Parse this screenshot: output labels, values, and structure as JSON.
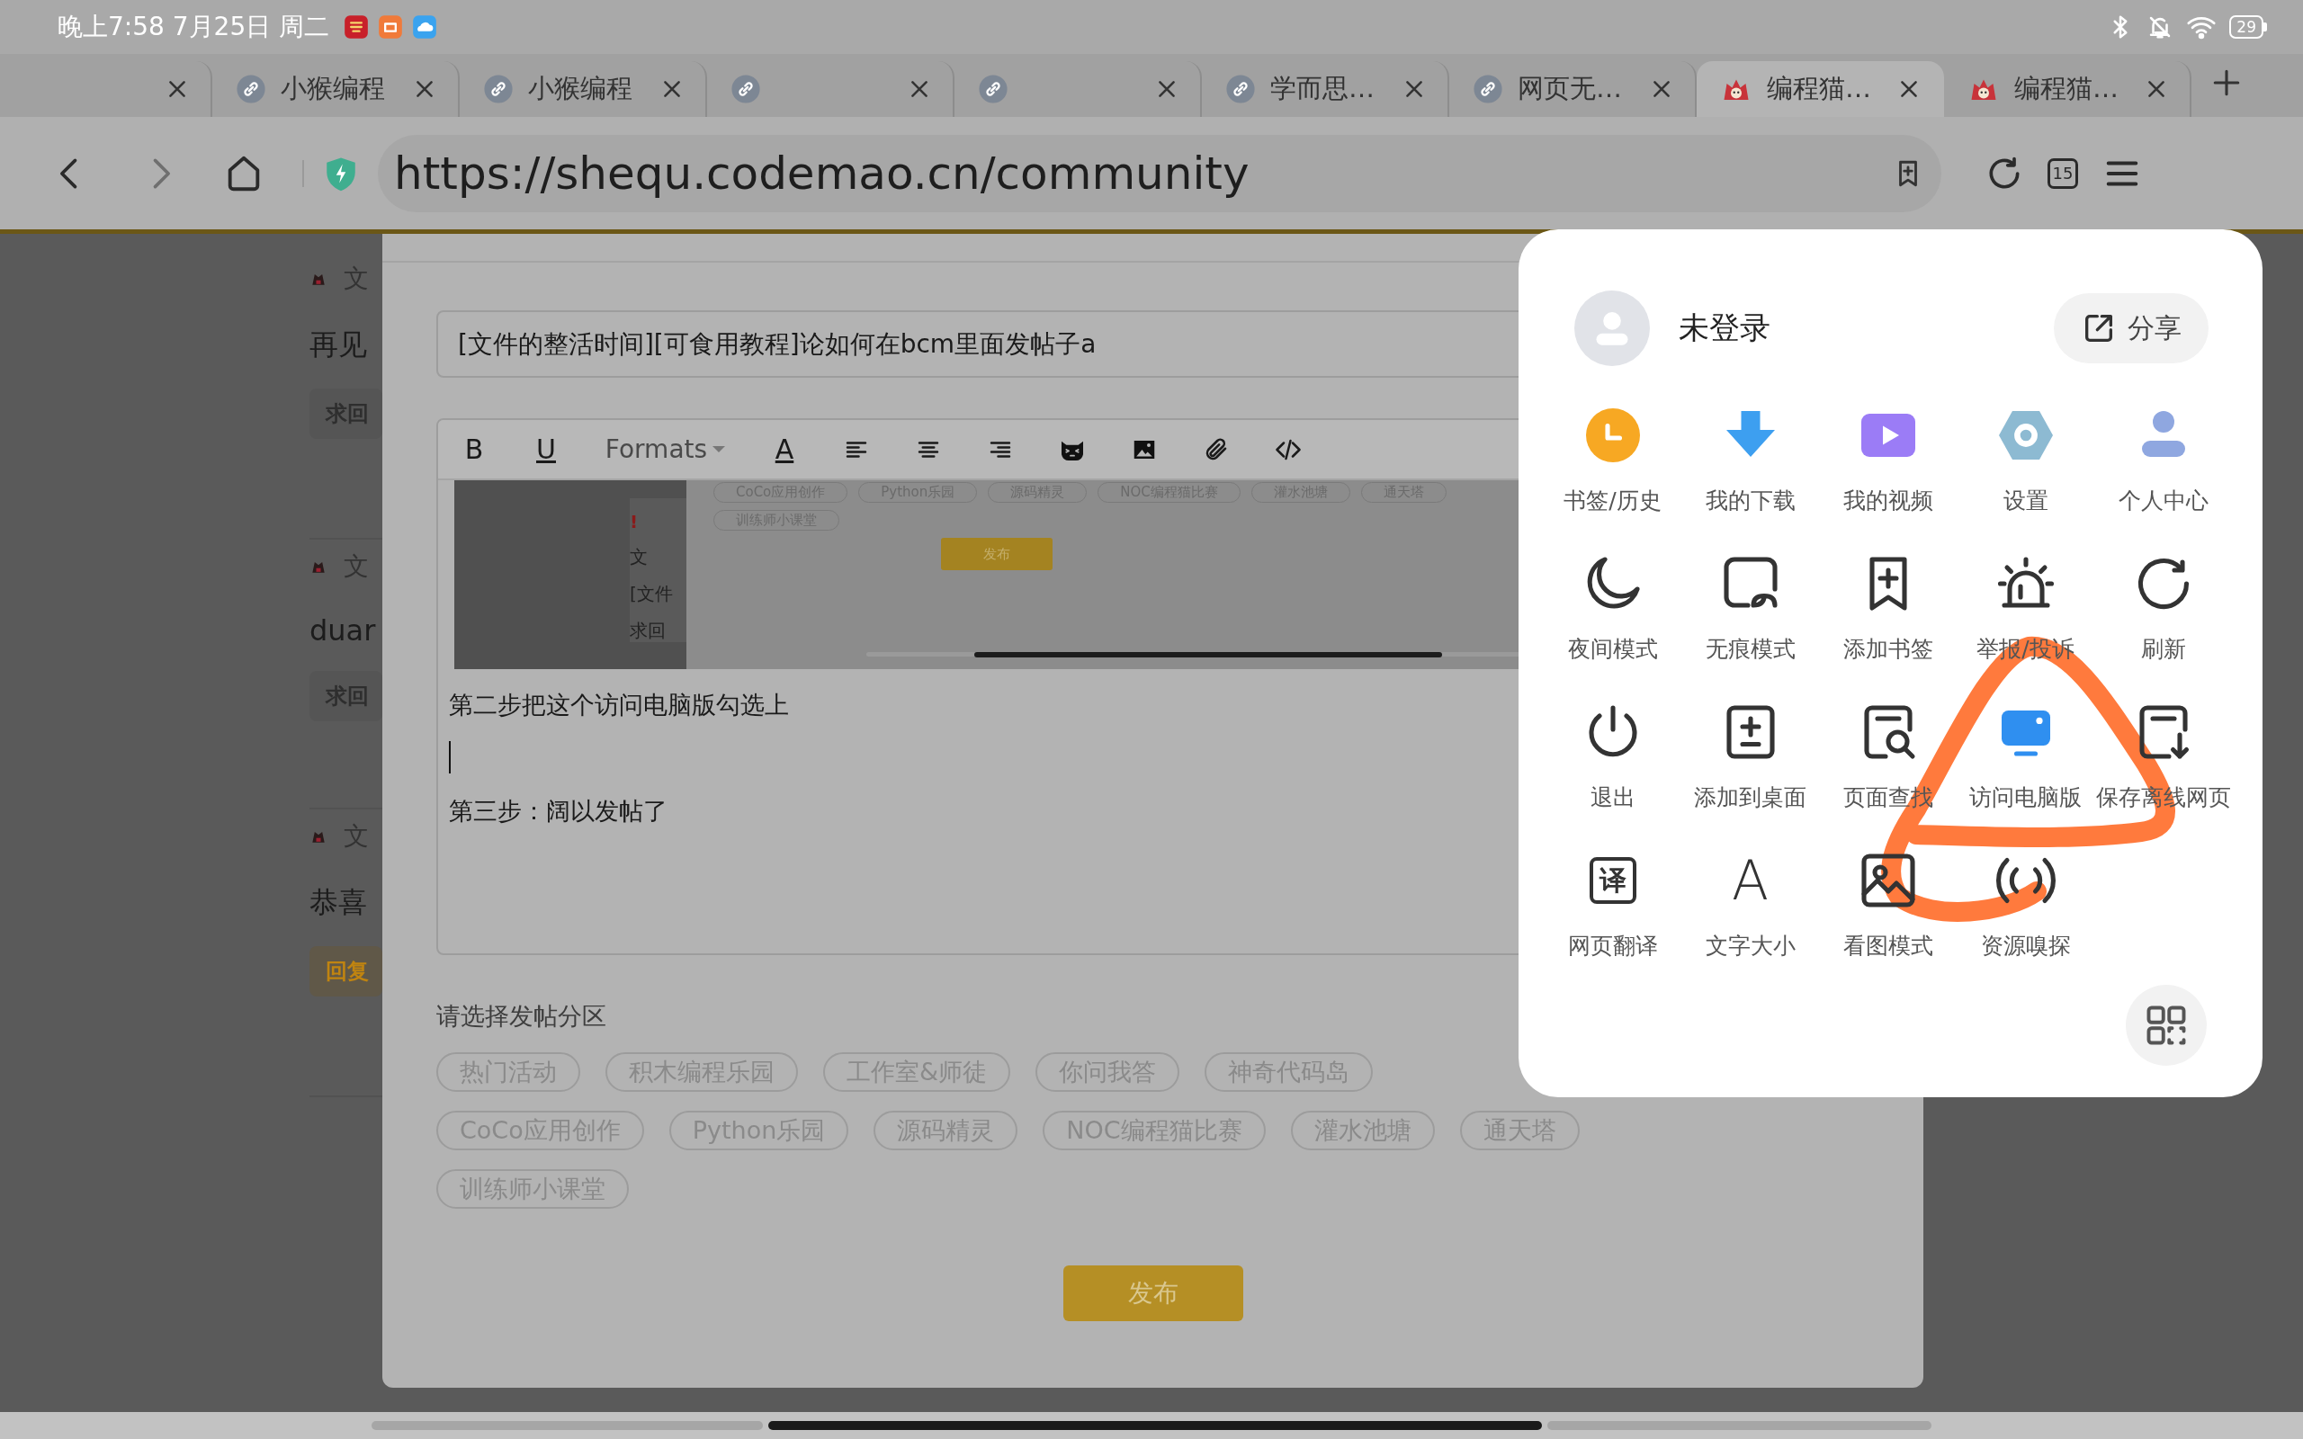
{
  "status_bar": {
    "time": "晚上7:58 7月25日 周二",
    "battery": "29"
  },
  "tabs": [
    {
      "kind": "blank",
      "selected": false
    },
    {
      "kind": "link",
      "label": "小猴编程",
      "selected": false
    },
    {
      "kind": "link",
      "label": "小猴编程",
      "selected": false
    },
    {
      "kind": "link",
      "selected": false
    },
    {
      "kind": "link",
      "selected": false
    },
    {
      "kind": "link",
      "label": "学而思…",
      "selected": false
    },
    {
      "kind": "link",
      "label": "网页无…",
      "selected": false
    },
    {
      "kind": "mascot",
      "label": "编程猫…",
      "selected": true
    },
    {
      "kind": "mascot",
      "label": "编程猫…",
      "selected": false
    }
  ],
  "address_bar": {
    "url": "https://shequ.codemao.cn/community",
    "tab_count": "15"
  },
  "sidebar_posts": [
    {
      "head": "文",
      "title": "再见",
      "tag": "求回",
      "highlighted": false
    },
    {
      "head": "文",
      "title": "duar",
      "tag": "求回",
      "highlighted": false
    },
    {
      "head": "文",
      "title": "恭喜",
      "tag": "回复",
      "highlighted": true
    }
  ],
  "editor": {
    "title": "[文件的整活时间][可食用教程]论如何在bcm里面发帖子a",
    "toolbar": {
      "bold": "B",
      "underline": "U",
      "formats": "Formats",
      "font_color": "A"
    },
    "screenshot": {
      "mark": "!",
      "head": "文",
      "title": "[文件",
      "tag": "求回",
      "tag_rows": [
        [
          "CoCo应用创作",
          "Python乐园",
          "源码精灵",
          "NOC编程猫比赛",
          "灌水池塘",
          "通天塔"
        ],
        [
          "训练师小课堂"
        ]
      ],
      "button": "发布"
    },
    "paragraphs": [
      "第二步把这个访问电脑版勾选上",
      "第三步：阔以发帖了"
    ],
    "section_label": "请选择发帖分区",
    "section_rows": [
      [
        {
          "label": "热门活动",
          "selected": false
        },
        {
          "label": "积木编程乐园",
          "selected": false
        },
        {
          "label": "工作室&师徒",
          "selected": false
        },
        {
          "label": "你问我答",
          "selected": false
        },
        {
          "label": "神奇代码岛",
          "selected": false
        }
      ],
      [
        {
          "label": "CoCo应用创作",
          "selected": false
        },
        {
          "label": "Python乐园",
          "selected": false
        },
        {
          "label": "源码精灵",
          "selected": false
        },
        {
          "label": "NOC编程猫比赛",
          "selected": false
        },
        {
          "label": "灌水池塘",
          "selected": false
        },
        {
          "label": "通天塔",
          "selected": false
        }
      ],
      [
        {
          "label": "训练师小课堂",
          "selected": false
        }
      ]
    ],
    "publish": "发布"
  },
  "menu": {
    "user": "未登录",
    "share": "分享",
    "items": [
      {
        "kind": "icon",
        "label": "书签/历史",
        "on": false
      },
      {
        "kind": "icon",
        "label": "我的下载",
        "on": false
      },
      {
        "kind": "icon",
        "label": "我的视频",
        "on": false
      },
      {
        "kind": "icon",
        "label": "设置",
        "on": false
      },
      {
        "kind": "icon",
        "label": "个人中心",
        "on": false
      },
      {
        "kind": "icon",
        "label": "夜间模式",
        "on": false
      },
      {
        "kind": "icon",
        "label": "无痕模式",
        "on": false
      },
      {
        "kind": "icon",
        "label": "添加书签",
        "on": false
      },
      {
        "kind": "icon",
        "label": "举报/投诉",
        "on": false
      },
      {
        "kind": "icon",
        "label": "刷新",
        "on": false
      },
      {
        "kind": "icon",
        "label": "退出",
        "on": false
      },
      {
        "kind": "icon",
        "label": "添加到桌面",
        "on": false
      },
      {
        "kind": "icon",
        "label": "页面查找",
        "on": false
      },
      {
        "kind": "icon",
        "label": "访问电脑版",
        "on": true
      },
      {
        "kind": "icon",
        "label": "保存离线网页",
        "on": false
      },
      {
        "kind": "boxed-glyph",
        "glyph": "译",
        "label": "网页翻译",
        "on": false
      },
      {
        "kind": "glyph",
        "glyph": "A",
        "label": "文字大小",
        "on": false
      },
      {
        "kind": "icon",
        "label": "看图模式",
        "on": false
      },
      {
        "kind": "icon",
        "label": "资源嗅探",
        "on": false
      }
    ]
  }
}
